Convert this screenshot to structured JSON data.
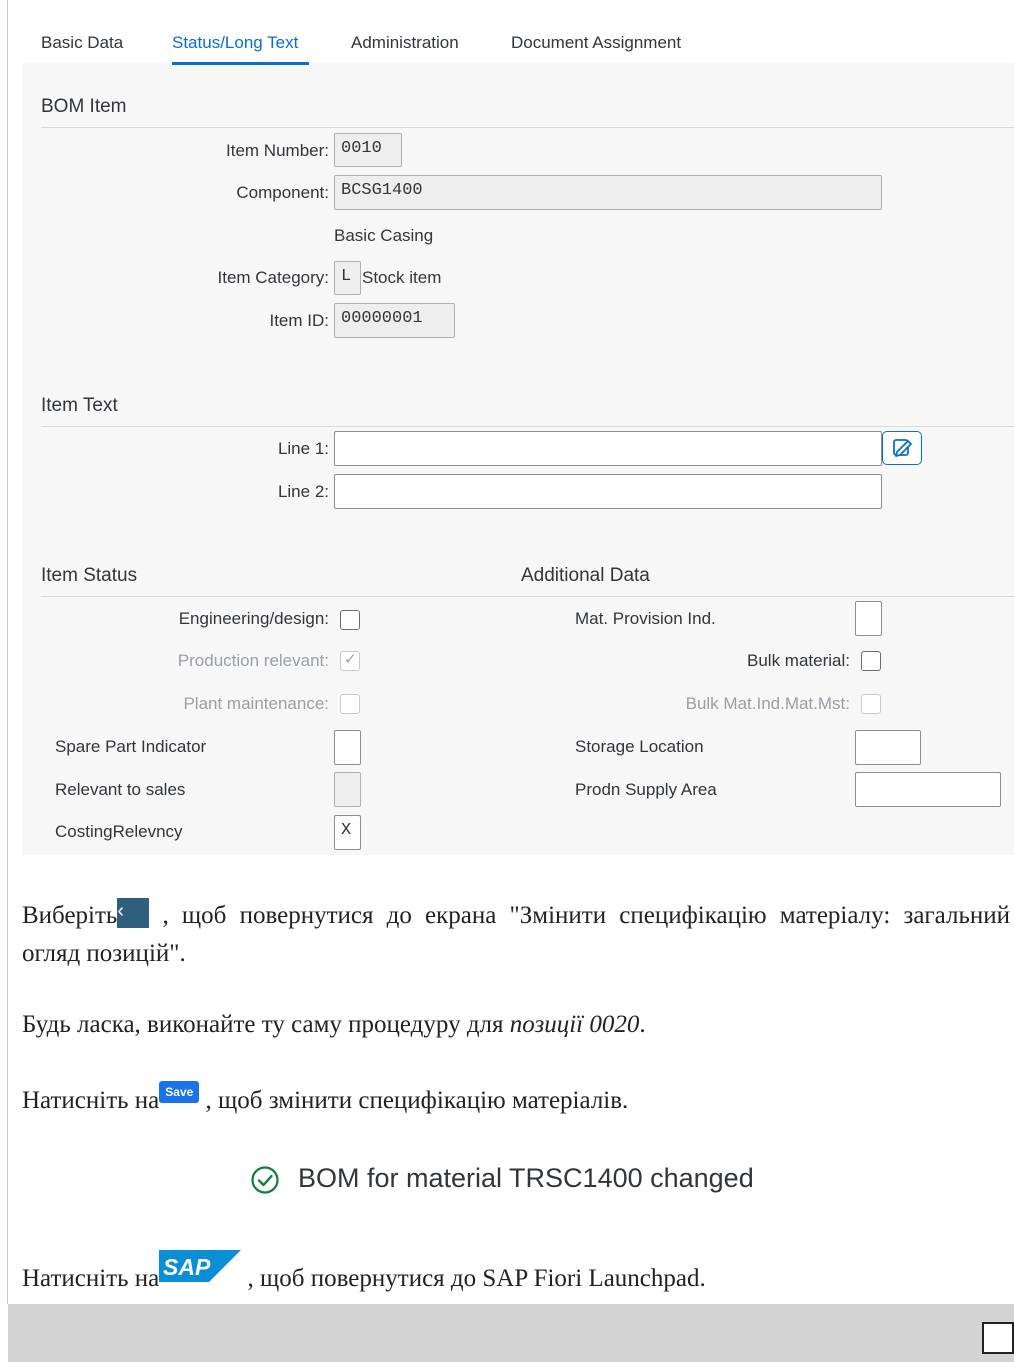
{
  "tabs": [
    "Basic Data",
    "Status/Long Text",
    "Administration",
    "Document Assignment"
  ],
  "bom_item": {
    "title": "BOM Item",
    "item_number_label": "Item Number:",
    "item_number": "0010",
    "component_label": "Component:",
    "component": "BCSG1400",
    "component_desc": "Basic Casing",
    "item_category_label": "Item Category:",
    "item_category": "L",
    "item_category_desc": "Stock item",
    "item_id_label": "Item ID:",
    "item_id": "00000001"
  },
  "item_text": {
    "title": "Item Text",
    "line1_label": "Line 1:",
    "line1": "",
    "line2_label": "Line 2:",
    "line2": ""
  },
  "item_status": {
    "title": "Item Status",
    "engineering_label": "Engineering/design:",
    "engineering_checked": false,
    "production_label": "Production relevant:",
    "production_checked": true,
    "plant_label": "Plant maintenance:",
    "plant_checked": false,
    "spare_part_label": "Spare Part Indicator",
    "spare_part": "",
    "relevant_sales_label": "Relevant to sales",
    "relevant_sales": "",
    "costing_label": "CostingRelevncy",
    "costing": "X"
  },
  "additional_data": {
    "title": "Additional Data",
    "mat_provision_label": "Mat. Provision Ind.",
    "mat_provision": "",
    "bulk_material_label": "Bulk material:",
    "bulk_material_checked": false,
    "bulk_mat_ind_label": "Bulk Mat.Ind.Mat.Mst:",
    "bulk_mat_ind_checked": false,
    "storage_location_label": "Storage Location",
    "storage_location": "",
    "prodn_supply_label": "Prodn Supply Area",
    "prodn_supply": ""
  },
  "instructions": {
    "p1_before": "Виберіть",
    "back_button_glyph": "‹",
    "p1_after": " , щоб повернутися до екрана \"Змінити специфікацію матеріалу: загальний огляд позицій\".",
    "p2_before": "Будь ласка, виконайте ту саму процедуру для ",
    "p2_italic": "позиції 0020",
    "p2_after": ".",
    "p3_before": "Натисніть на",
    "save_button_label": "Save",
    "p3_after": " , щоб змінити специфікацію матеріалів.",
    "status_message": "BOM for material TRSC1400 changed",
    "p4_before": "Натисніть на",
    "sap_logo_text": "SAP",
    "p4_after": " , щоб повернутися до SAP Fiori Launchpad."
  },
  "colors": {
    "accent": "#0a6ed1",
    "success": "#107e3e",
    "sap_logo": "#0a8fd6",
    "save_button": "#1a73e8",
    "back_button": "#2f5f7c"
  },
  "icons": [
    "edit-icon",
    "back-chevron-icon",
    "save-icon",
    "sap-logo-icon",
    "success-check-icon",
    "checkmark-icon"
  ]
}
